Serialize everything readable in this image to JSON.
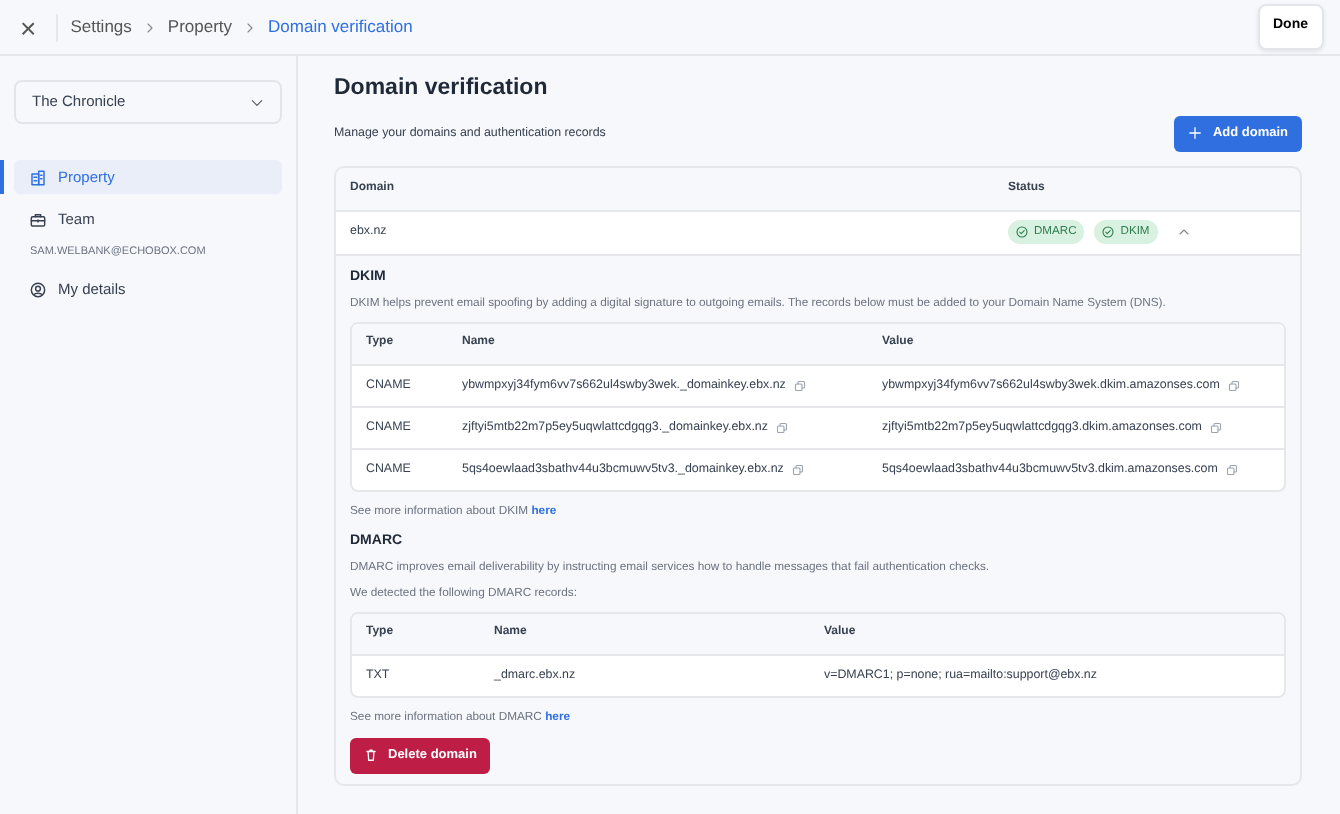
{
  "header": {
    "close": "×",
    "breadcrumbs": [
      {
        "label": "Settings",
        "selected": false
      },
      {
        "label": "Property",
        "selected": false
      },
      {
        "label": "Domain verification",
        "selected": true
      }
    ],
    "done_button": "Done"
  },
  "sidebar": {
    "account_selector": "The Chronicle",
    "items": [
      {
        "label": "Property",
        "kind": "building",
        "selected": true
      },
      {
        "label": "Team",
        "kind": "briefcase",
        "selected": false
      }
    ],
    "section_label": "SAM.WELBANK@ECHOBOX.COM",
    "user_items": [
      {
        "label": "My details",
        "kind": "user",
        "selected": false
      }
    ]
  },
  "main": {
    "title": "Domain verification",
    "subtitle": "Manage your domains and authentication records",
    "add_button": "Add domain",
    "table": {
      "columns": [
        "Domain",
        "Status"
      ],
      "rows": [
        {
          "domain": "ebx.nz",
          "expanded": true,
          "statuses": [
            {
              "label": "DMARC",
              "verified": true
            },
            {
              "label": "DKIM",
              "verified": true
            }
          ],
          "dkim": {
            "title": "DKIM",
            "description": [
              "DKIM helps prevent email spoofing by adding a digital signature to outgoing emails. The records below must be added to your Domain Name System (DNS)."
            ],
            "columns": [
              "Type",
              "Name",
              "Value"
            ],
            "records": [
              {
                "type": "CNAME",
                "name": "ybwmpxyj34fym6vv7s662ul4swby3wek._domainkey.ebx.nz",
                "value": "ybwmpxyj34fym6vv7s662ul4swby3wek.dkim.amazonses.com"
              },
              {
                "type": "CNAME",
                "name": "zjftyi5mtb22m7p5ey5uqwlattcdgqg3._domainkey.ebx.nz",
                "value": "zjftyi5mtb22m7p5ey5uqwlattcdgqg3.dkim.amazonses.com"
              },
              {
                "type": "CNAME",
                "name": "5qs4oewlaad3sbathv44u3bcmuwv5tv3._domainkey.ebx.nz",
                "value": "5qs4oewlaad3sbathv44u3bcmuwv5tv3.dkim.amazonses.com"
              }
            ],
            "more_text": "See more information about DKIM",
            "more_link": "here"
          },
          "dmarc": {
            "title": "DMARC",
            "description": [
              "DMARC improves email deliverability by instructing email services how to handle messages that fail authentication checks.",
              "We detected the following DMARC records:"
            ],
            "columns": [
              "Type",
              "Name",
              "Value"
            ],
            "records": [
              {
                "type": "TXT",
                "name": "_dmarc.ebx.nz",
                "value": "v=DMARC1; p=none; rua=mailto:support@ebx.nz"
              }
            ],
            "more_text": "See more information about DMARC",
            "more_link": "here"
          },
          "delete_button": "Delete domain"
        }
      ]
    }
  }
}
